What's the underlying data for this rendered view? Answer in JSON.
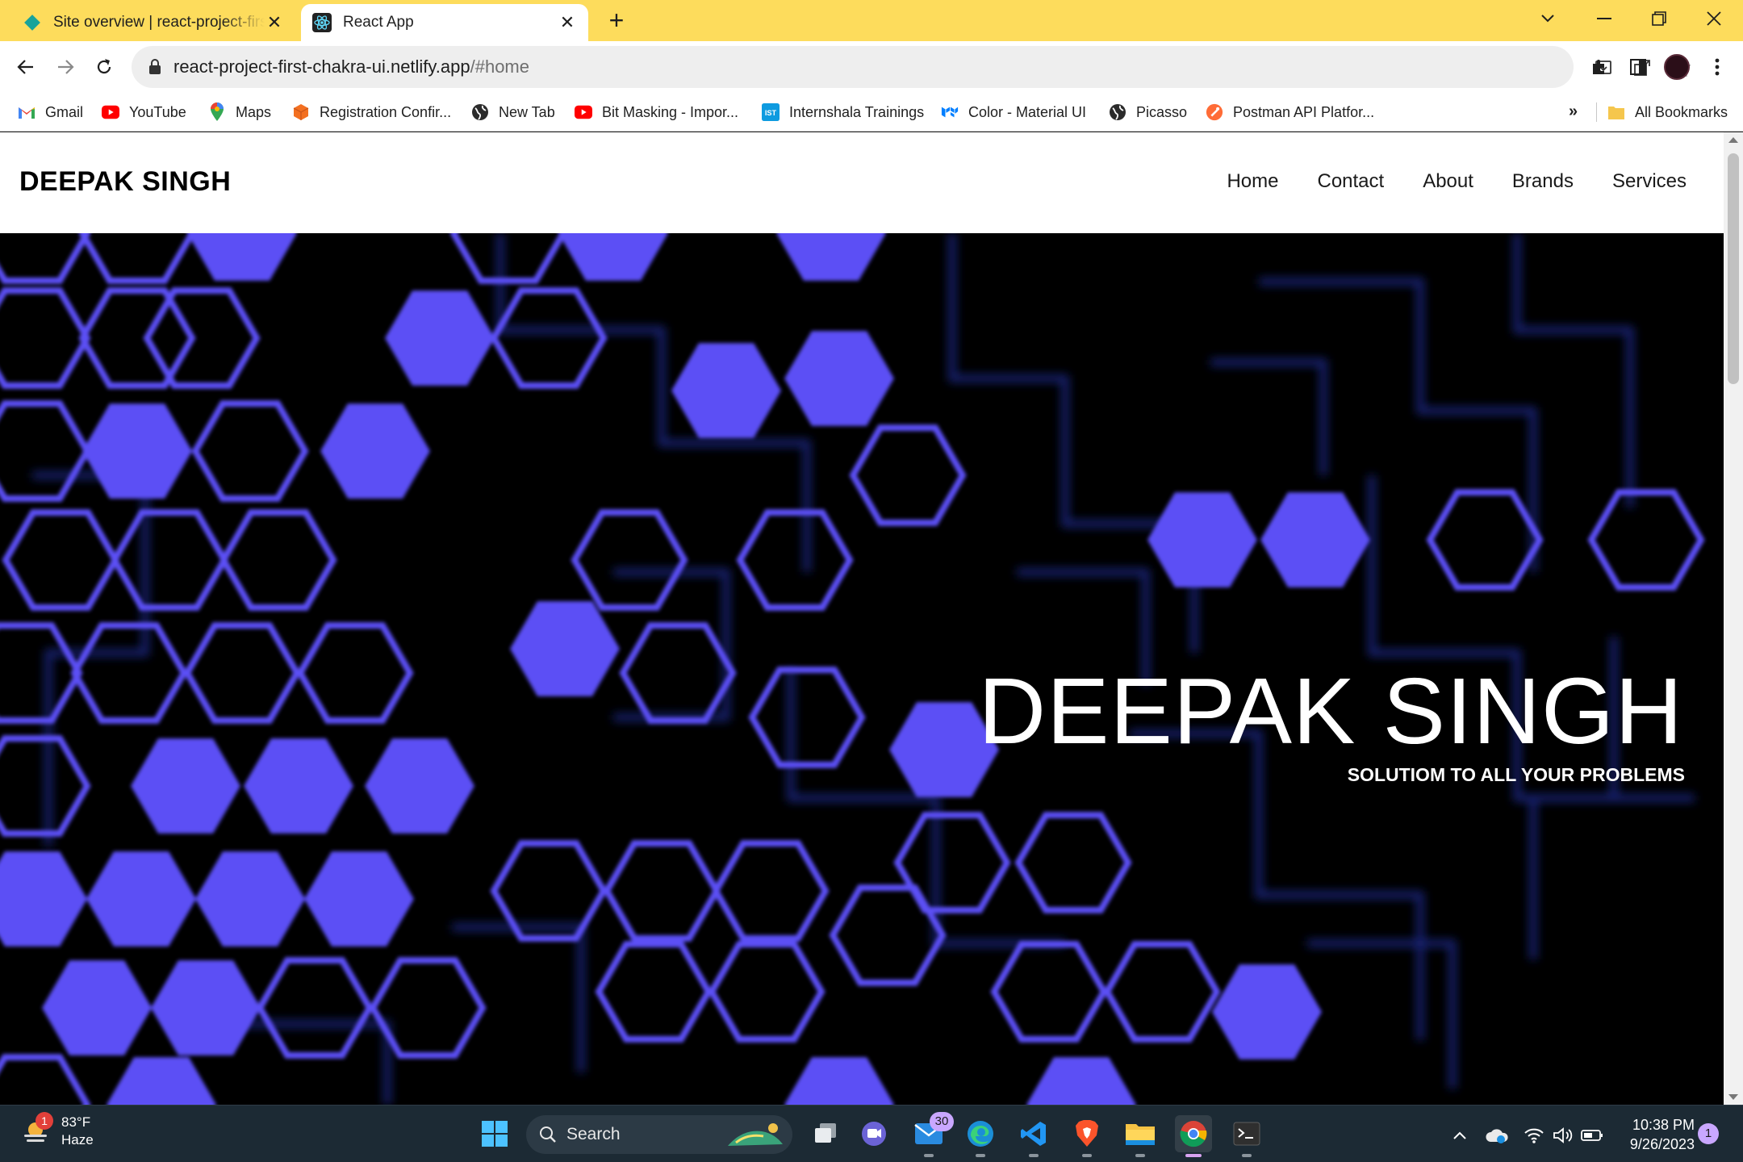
{
  "browser": {
    "tabs": [
      {
        "title": "Site overview | react-project-first",
        "active": false
      },
      {
        "title": "React App",
        "active": true
      }
    ],
    "url_host": "react-project-first-chakra-ui.netlify.app",
    "url_path": "/#home",
    "bookmarks": [
      {
        "label": "Gmail",
        "icon": "gmail-icon"
      },
      {
        "label": "YouTube",
        "icon": "youtube-icon"
      },
      {
        "label": "Maps",
        "icon": "maps-icon"
      },
      {
        "label": "Registration Confir...",
        "icon": "cube-icon"
      },
      {
        "label": "New Tab",
        "icon": "globe-icon"
      },
      {
        "label": "Bit Masking - Impor...",
        "icon": "youtube-icon"
      },
      {
        "label": "Internshala Trainings",
        "icon": "ist-icon"
      },
      {
        "label": "Color - Material UI",
        "icon": "mui-icon"
      },
      {
        "label": "Picasso",
        "icon": "globe-icon"
      },
      {
        "label": "Postman API Platfor...",
        "icon": "postman-icon"
      }
    ],
    "more_bookmarks": "»",
    "all_bookmarks": "All Bookmarks",
    "accent_color": "#fddc5c"
  },
  "site": {
    "logo": "DEEPAK SINGH",
    "nav": [
      "Home",
      "Contact",
      "About",
      "Brands",
      "Services"
    ],
    "hero_title": "DEEPAK SINGH",
    "hero_subtitle": "SOLUTIOM TO ALL YOUR PROBLEMS",
    "hero_accent": "#5b50f5"
  },
  "taskbar": {
    "weather_badge": "1",
    "temperature": "83°F",
    "condition": "Haze",
    "search_label": "Search",
    "mail_badge": "30",
    "time": "10:38 PM",
    "date": "9/26/2023",
    "notification_count": "1"
  }
}
